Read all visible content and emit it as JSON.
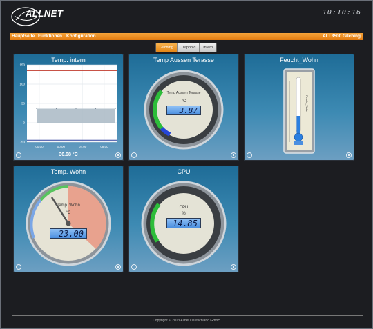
{
  "header": {
    "logo_text": "ALLNET",
    "clock": "10:10:16"
  },
  "navbar": {
    "items": [
      "Hauptseite",
      "Funktionen",
      "Konfiguration"
    ],
    "device": "ALL3500 Gilching"
  },
  "tabs": [
    {
      "label": "Gilching",
      "active": true
    },
    {
      "label": "Trappold",
      "active": false
    },
    {
      "label": "intern",
      "active": false
    }
  ],
  "panels": {
    "temp_intern": {
      "title": "Temp. intern",
      "value_text": "36.68 °C"
    },
    "temp_aussen": {
      "title": "Temp Aussen Terasse",
      "gauge_label": "Temp Aussen Terasse",
      "unit": "°C",
      "value": "3.87"
    },
    "feucht_wohn": {
      "title": "Feucht_Wohn",
      "gauge_label": "Feucht_Wohn"
    },
    "temp_wohn": {
      "title": "Temp. Wohn",
      "gauge_label": "Temp. Wohn",
      "unit": "°C",
      "value": "23.00"
    },
    "cpu": {
      "title": "CPU",
      "gauge_label": "CPU",
      "unit": "%",
      "value": "14.85"
    }
  },
  "chart_data": {
    "type": "area",
    "title": "Temp. intern",
    "x_ticks": [
      "00:00",
      "00:00",
      "04:00",
      "08:00"
    ],
    "y_ticks": [
      150,
      100,
      50,
      0,
      -50
    ],
    "ylim": [
      -50,
      150
    ],
    "reference_lines": [
      {
        "value": 135,
        "color": "#c0392b"
      },
      {
        "value": -45,
        "color": "#2c3e9e"
      }
    ],
    "series": [
      {
        "values": [
          36.68,
          36.68,
          36.68,
          36.68,
          36.68
        ]
      }
    ]
  },
  "footer": {
    "copyright": "Copyright © 2013 Allnet Deutschland GmbH"
  },
  "colors": {
    "accent": "#f29327",
    "panel": "#2d7eab"
  }
}
